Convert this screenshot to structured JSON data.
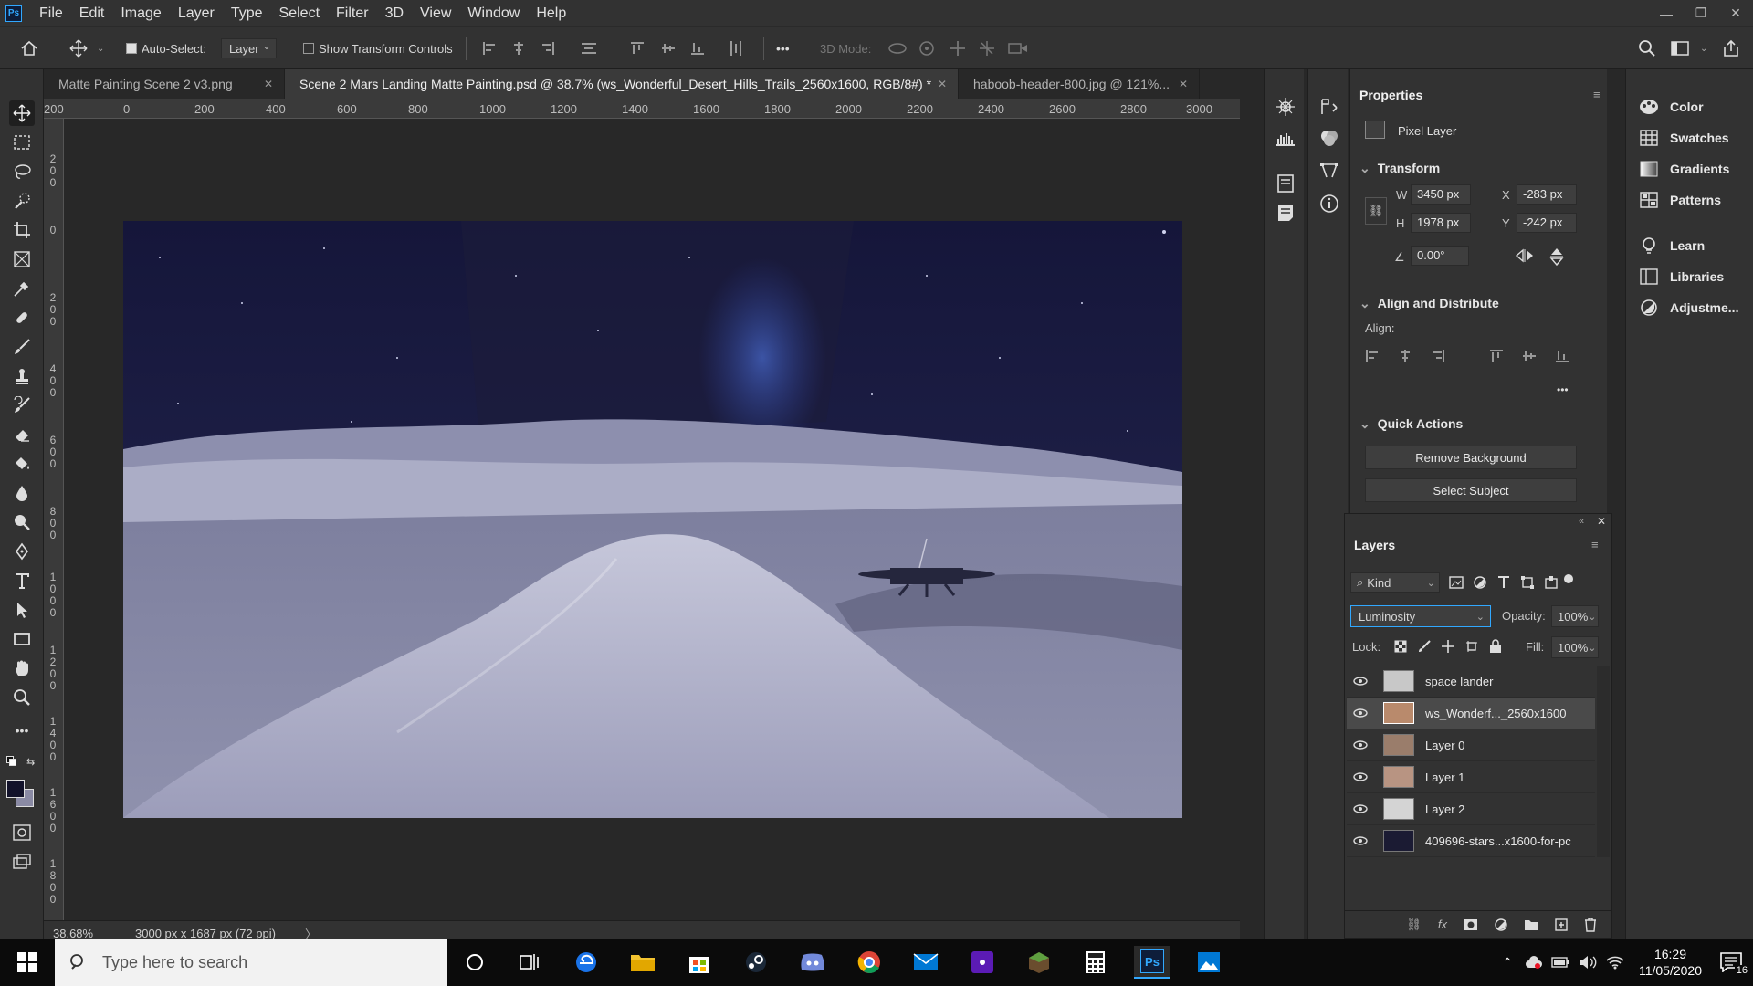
{
  "app": {
    "logo": "Ps"
  },
  "menu": [
    "File",
    "Edit",
    "Image",
    "Layer",
    "Type",
    "Select",
    "Filter",
    "3D",
    "View",
    "Window",
    "Help"
  ],
  "window_controls": {
    "minimize": "—",
    "restore": "❐",
    "close": "✕"
  },
  "options": {
    "auto_select_label": "Auto-Select:",
    "auto_select_value": "Layer",
    "transform_controls_label": "Show Transform Controls",
    "more": "•••",
    "mode_3d_label": "3D Mode:"
  },
  "tabs": [
    {
      "label": "Matte Painting Scene 2 v3.png",
      "close": "✕"
    },
    {
      "label": "Scene 2 Mars Landing Matte Painting.psd @ 38.7% (ws_Wonderful_Desert_Hills_Trails_2560x1600, RGB/8#) *",
      "close": "✕"
    },
    {
      "label": "haboob-header-800.jpg @ 121%...",
      "close": "✕"
    }
  ],
  "ruler_h": [
    "200",
    "0",
    "200",
    "400",
    "600",
    "800",
    "1000",
    "1200",
    "1400",
    "1600",
    "1800",
    "2000",
    "2200",
    "2400",
    "2600",
    "2800",
    "3000"
  ],
  "ruler_v": [
    "200",
    "0",
    "200",
    "400",
    "600",
    "800",
    "1000",
    "1200",
    "1400",
    "1600",
    "1800"
  ],
  "status": {
    "zoom": "38.68%",
    "doc_size": "3000 px x 1687 px (72 ppi)",
    "arrow": "〉"
  },
  "properties": {
    "title": "Properties",
    "layer_type": "Pixel Layer",
    "transform_header": "Transform",
    "w_label": "W",
    "w": "3450 px",
    "h_label": "H",
    "h": "1978 px",
    "x_label": "X",
    "x": "-283 px",
    "y_label": "Y",
    "y": "-242 px",
    "angle": "0.00°",
    "align_header": "Align and Distribute",
    "align_label": "Align:",
    "more": "•••",
    "quick_header": "Quick Actions",
    "remove_bg": "Remove Background",
    "select_subject": "Select Subject"
  },
  "right_panel": [
    "Color",
    "Swatches",
    "Gradients",
    "Patterns",
    "Learn",
    "Libraries",
    "Adjustme..."
  ],
  "layers": {
    "title": "Layers",
    "filter": "Kind",
    "blend_mode": "Luminosity",
    "opacity_label": "Opacity:",
    "opacity": "100%",
    "lock_label": "Lock:",
    "fill_label": "Fill:",
    "fill": "100%",
    "items": [
      {
        "name": "space lander",
        "thumb": "#c8c8c8"
      },
      {
        "name": "ws_Wonderf..._2560x1600",
        "thumb": "#b98a6c",
        "selected": true
      },
      {
        "name": "Layer 0",
        "thumb": "#9a7d6b"
      },
      {
        "name": "Layer 1",
        "thumb": "#b89482"
      },
      {
        "name": "Layer 2",
        "thumb": "#d4d4d4"
      },
      {
        "name": "409696-stars...x1600-for-pc",
        "thumb": "#1b1b33"
      }
    ]
  },
  "taskbar": {
    "search_placeholder": "Type here to search",
    "time": "16:29",
    "date": "11/05/2020",
    "notifications": "16"
  }
}
